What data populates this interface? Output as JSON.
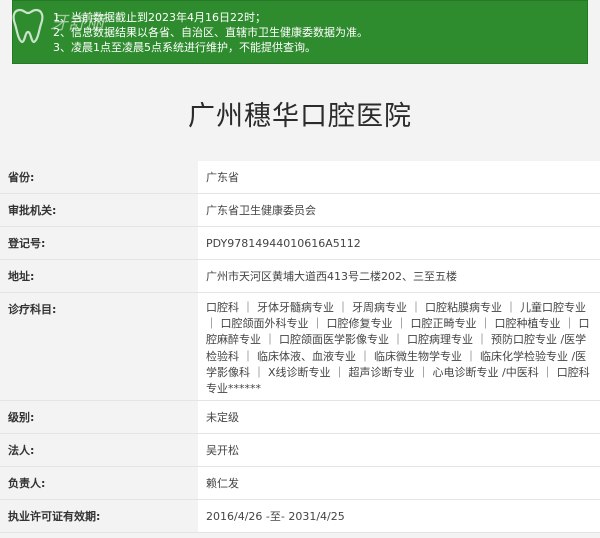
{
  "notice": {
    "lines": [
      "1、当前数据截止到2023年4月16日22时；",
      "2、信息数据结果以各省、自治区、直辖市卫生健康委数据为准。",
      "3、凌晨1点至凌晨5点系统进行维护，不能提供查询。"
    ]
  },
  "page": {
    "title": "广州穗华口腔医院"
  },
  "fields": [
    {
      "label": "省份:",
      "value": "广东省"
    },
    {
      "label": "审批机关:",
      "value": "广东省卫生健康委员会"
    },
    {
      "label": "登记号:",
      "value": "PDY97814944010616A5112"
    },
    {
      "label": "地址:",
      "value": "广州市天河区黄埔大道西413号二楼202、三至五楼"
    },
    {
      "label": "诊疗科目:",
      "value": "口腔科 ｜ 牙体牙髓病专业 ｜ 牙周病专业 ｜ 口腔粘膜病专业 ｜ 儿童口腔专业 ｜ 口腔颌面外科专业 ｜ 口腔修复专业 ｜ 口腔正畸专业 ｜ 口腔种植专业 ｜ 口腔麻醉专业 ｜ 口腔颌面医学影像专业 ｜ 口腔病理专业 ｜ 预防口腔专业 /医学检验科 ｜ 临床体液、血液专业 ｜ 临床微生物学专业 ｜ 临床化学检验专业 /医学影像科 ｜ X线诊断专业 ｜ 超声诊断专业 ｜ 心电诊断专业 /中医科 ｜ 口腔科专业******"
    },
    {
      "label": "级别:",
      "value": "未定级"
    },
    {
      "label": "法人:",
      "value": "吴开松"
    },
    {
      "label": "负责人:",
      "value": "赖仁发"
    },
    {
      "label": "执业许可证有效期:",
      "value": "2016/4/26 -至- 2031/4/25"
    }
  ],
  "colors": {
    "notice_bg": "#2e8b2e",
    "page_bg": "#f3f3f3"
  },
  "icons": {
    "watermark": "tooth-logo-icon"
  }
}
